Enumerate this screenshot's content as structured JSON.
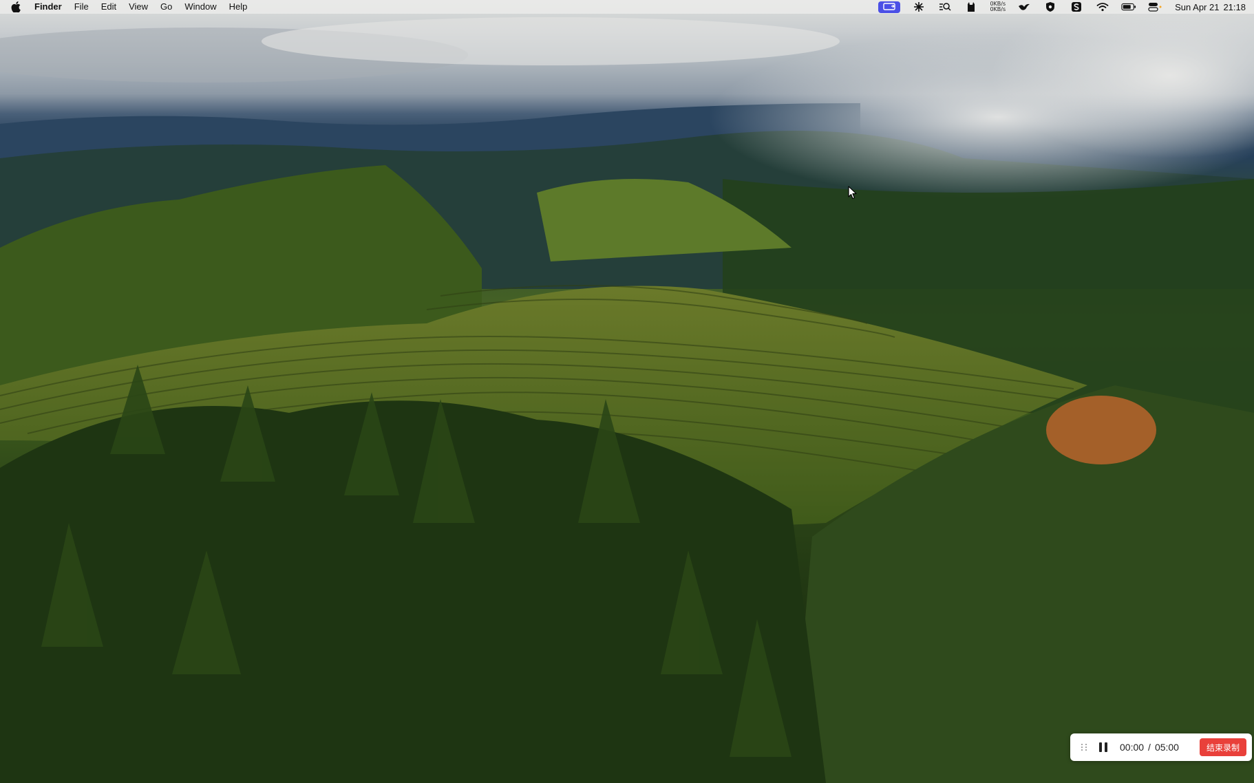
{
  "menubar": {
    "app_name": "Finder",
    "menus": [
      "File",
      "Edit",
      "View",
      "Go",
      "Window",
      "Help"
    ],
    "status_icons": [
      "screen-share-icon",
      "cluster-icon",
      "search-list-icon",
      "cat-icon",
      "network-speed-icon",
      "bird-icon",
      "shield-icon",
      "app-s-icon",
      "wifi-icon",
      "battery-icon",
      "control-center-icon"
    ],
    "network_speed": {
      "up": "0KB/s",
      "down": "0KB/s"
    },
    "date": "Sun Apr 21",
    "time": "21:18"
  },
  "desktop": {
    "wallpaper": "vineyard-hills-sunset",
    "colors": {
      "sky": "#c9cdd0",
      "mountains": "#2d4660",
      "vineyard": "#4a6522",
      "forest": "#1c3010"
    }
  },
  "recorder": {
    "elapsed": "00:00",
    "separator": "/",
    "limit": "05:00",
    "stop_label": "结束录制",
    "stop_color": "#e9403a"
  }
}
